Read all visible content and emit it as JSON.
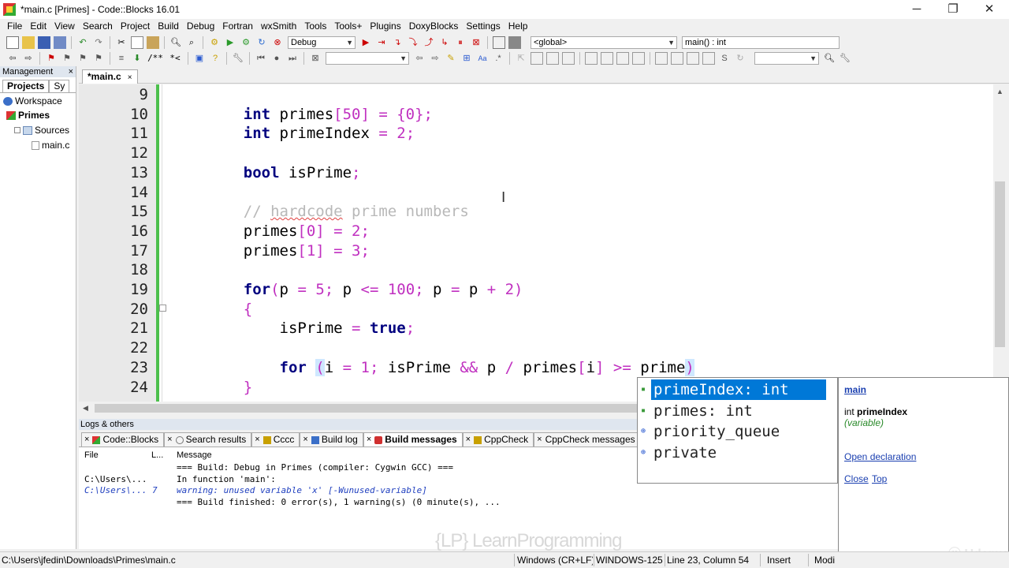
{
  "window": {
    "title": "*main.c [Primes] - Code::Blocks 16.01",
    "minimize": "─",
    "maximize": "❐",
    "close": "✕"
  },
  "menu": [
    "File",
    "Edit",
    "View",
    "Search",
    "Project",
    "Build",
    "Debug",
    "Fortran",
    "wxSmith",
    "Tools",
    "Tools+",
    "Plugins",
    "DoxyBlocks",
    "Settings",
    "Help"
  ],
  "toolbar": {
    "build_target": "Debug",
    "scope": "<global>",
    "function": "main() : int",
    "doc_comment_1": "/**",
    "doc_comment_2": "*<",
    "search_field": "",
    "search_field_2": ""
  },
  "management": {
    "header": "Management",
    "close": "×",
    "tabs": [
      "Projects",
      "Sy"
    ],
    "tree": [
      {
        "label": "Workspace",
        "icon": "workspace-icon"
      },
      {
        "label": "Primes",
        "icon": "project-icon"
      },
      {
        "label": "Sources",
        "icon": "folder-icon"
      },
      {
        "label": "main.c",
        "icon": "file-icon"
      }
    ]
  },
  "editor": {
    "tab": "*main.c",
    "tab_close": "×",
    "lines": [
      {
        "n": "9",
        "html": ""
      },
      {
        "n": "10",
        "html": "    <span class='kw'>int</span> primes<span class='pu'>[50] = {0};</span>"
      },
      {
        "n": "11",
        "html": "    <span class='kw'>int</span> primeIndex <span class='pu'>= 2;</span>"
      },
      {
        "n": "12",
        "html": ""
      },
      {
        "n": "13",
        "html": "    <span class='kw'>bool</span> isPrime<span class='pu'>;</span>"
      },
      {
        "n": "14",
        "html": ""
      },
      {
        "n": "15",
        "html": "    <span class='cm'>// <span class='sq'>hardcode</span> prime numbers</span>"
      },
      {
        "n": "16",
        "html": "    primes<span class='pu'>[0] = 2;</span>"
      },
      {
        "n": "17",
        "html": "    primes<span class='pu'>[1] = 3;</span>"
      },
      {
        "n": "18",
        "html": ""
      },
      {
        "n": "19",
        "html": "    <span class='kw'>for</span><span class='pu'>(</span>p <span class='pu'>= 5;</span> p <span class='pu'>&lt;= 100;</span> p <span class='pu'>=</span> p <span class='pu'>+ 2)</span>"
      },
      {
        "n": "20",
        "html": "    <span class='pu'>{</span>"
      },
      {
        "n": "21",
        "html": "        isPrime <span class='pu'>=</span> <span class='kw'>true</span><span class='pu'>;</span>"
      },
      {
        "n": "22",
        "html": ""
      },
      {
        "n": "23",
        "html": "        <span class='kw'>for</span> <span class='pu hl'>(</span>i <span class='pu'>= 1;</span> isPrime <span class='pu'>&amp;&amp;</span> p <span class='pu'>/</span> primes<span class='pu'>[</span>i<span class='pu'>] &gt;=</span> prime<span class='pu hl'>)</span>"
      },
      {
        "n": "24",
        "html": "    <span class='pu'>}</span>"
      }
    ]
  },
  "logs": {
    "header": "Logs & others",
    "tabs": [
      {
        "label": "Code::Blocks",
        "active": false
      },
      {
        "label": "Search results",
        "active": false
      },
      {
        "label": "Cccc",
        "active": false
      },
      {
        "label": "Build log",
        "active": false
      },
      {
        "label": "Build messages",
        "active": true
      },
      {
        "label": "CppCheck",
        "active": false
      },
      {
        "label": "CppCheck messages",
        "active": false
      }
    ],
    "columns": {
      "file": "File",
      "line": "L...",
      "message": "Message"
    },
    "rows": [
      {
        "file": "",
        "line": "",
        "message": "=== Build: Debug in Primes (compiler: Cygwin GCC) ===",
        "warning": false
      },
      {
        "file": "C:\\Users\\...",
        "line": "",
        "message": "In function 'main':",
        "warning": false
      },
      {
        "file": "C:\\Users\\...",
        "line": "7",
        "message": "warning: unused variable 'x' [-Wunused-variable]",
        "warning": true
      },
      {
        "file": "",
        "line": "",
        "message": "=== Build finished: 0 error(s), 1 warning(s) (0 minute(s), ...",
        "warning": false
      }
    ]
  },
  "autocomplete": {
    "items": [
      {
        "label": "primeIndex: int",
        "icon": "variable-icon",
        "glyph": "▪",
        "selected": true
      },
      {
        "label": "primes: int",
        "icon": "variable-icon",
        "glyph": "▪",
        "selected": false
      },
      {
        "label": "priority_queue",
        "icon": "class-icon",
        "glyph": "⊕",
        "selected": false
      },
      {
        "label": "private",
        "icon": "keyword-icon",
        "glyph": "⊕",
        "selected": false
      }
    ],
    "doc": {
      "scope": "main",
      "type": "int",
      "name": "primeIndex",
      "kind": "(variable)",
      "open_declaration": "Open declaration",
      "close": "Close",
      "top": "Top"
    }
  },
  "statusbar": {
    "path": "C:\\Users\\jfedin\\Downloads\\Primes\\main.c",
    "eol": "Windows (CR+LF)",
    "encoding": "WINDOWS-125",
    "position": "Line 23, Column 54",
    "mode": "Insert",
    "modified": "Modi"
  },
  "colors": {
    "accent": "#0078d7",
    "keyword": "#00007f",
    "operator": "#c030c0",
    "comment": "#b8b8b8",
    "change_bar": "#4cc04c"
  }
}
